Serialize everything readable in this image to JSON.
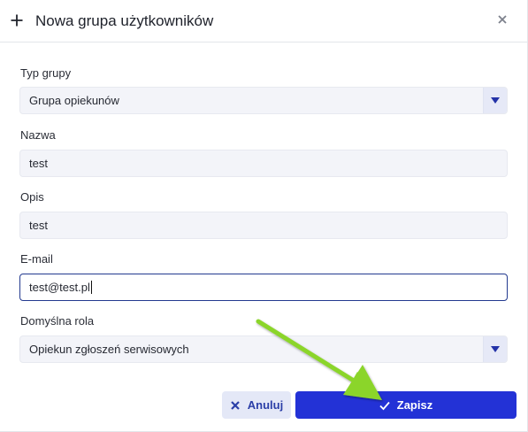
{
  "header": {
    "title": "Nowa grupa użytkowników",
    "icons": {
      "add": "plus-icon",
      "close": "close-icon"
    }
  },
  "form": {
    "group_type": {
      "label": "Typ grupy",
      "value": "Grupa opiekunów",
      "toggle_icon": "triangle-down-icon"
    },
    "name": {
      "label": "Nazwa",
      "value": "test"
    },
    "description": {
      "label": "Opis",
      "value": "test"
    },
    "email": {
      "label": "E-mail",
      "value": "test@test.pl",
      "focused": true
    },
    "default_role": {
      "label": "Domyślna rola",
      "value": "Opiekun zgłoszeń serwisowych",
      "toggle_icon": "triangle-down-icon"
    }
  },
  "actions": {
    "cancel_label": "Anuluj",
    "cancel_icon": "x-icon",
    "save_label": "Zapisz",
    "save_icon": "checkmark-icon"
  },
  "colors": {
    "primary": "#2332d6",
    "secondary_bg": "#e4e8f7",
    "field_bg": "#f3f4f9",
    "focus_border": "#233a8f",
    "annotation_arrow": "#8bd52b"
  },
  "annotation": {
    "type": "arrow",
    "points_to": "save-button"
  }
}
